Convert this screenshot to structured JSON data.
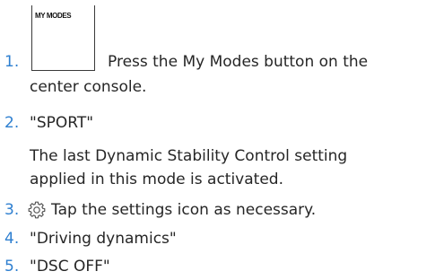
{
  "steps": [
    {
      "number": "1.",
      "button_label": "MY MODES",
      "text_line1": "Press the My Modes button on the",
      "text_line2": "center console."
    },
    {
      "number": "2.",
      "text": "\"SPORT\"",
      "note_line1": "The last Dynamic Stability Control setting",
      "note_line2": "applied in this mode is activated."
    },
    {
      "number": "3.",
      "icon": "settings-gear",
      "text": "Tap the settings icon as necessary."
    },
    {
      "number": "4.",
      "text": "\"Driving dynamics\""
    },
    {
      "number": "5.",
      "text": "\"DSC OFF\""
    }
  ],
  "colors": {
    "step_number": "#2e7fd0",
    "text": "#262626"
  }
}
